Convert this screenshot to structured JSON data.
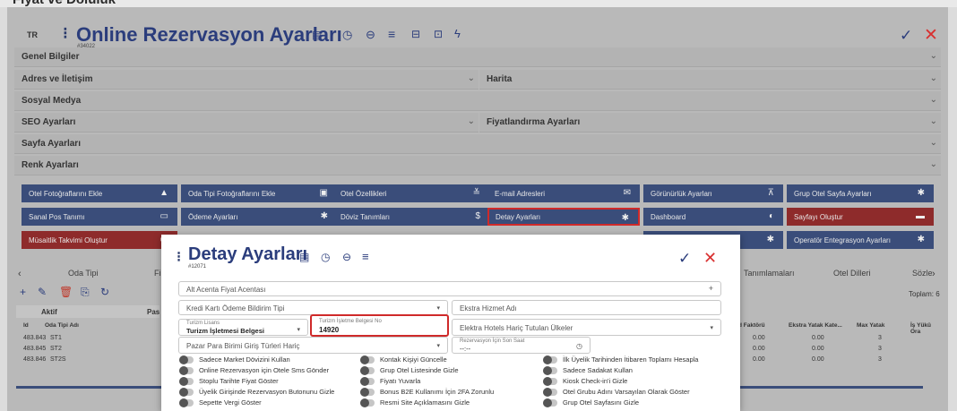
{
  "top_strip": "Fiyat ve Doluluk",
  "header": {
    "lang": "TR",
    "title": "Online Rezervasyon Ayarları",
    "subid": "#34022",
    "icons": [
      "list-icon",
      "history-icon",
      "lock-icon",
      "menu-icon",
      "print-icon",
      "save-icon",
      "bolt-icon"
    ]
  },
  "accordions": [
    {
      "label": "Genel Bilgiler"
    },
    {
      "label": "Adres ve İletişim"
    },
    {
      "label": "Harita"
    },
    {
      "label": "Sosyal Medya"
    },
    {
      "label": "SEO Ayarları"
    },
    {
      "label": "Fiyatlandırma Ayarları"
    },
    {
      "label": "Sayfa Ayarları"
    },
    {
      "label": "Renk Ayarları"
    }
  ],
  "buttons": [
    {
      "label": "Otel Fotoğraflarını Ekle",
      "icon": "▲"
    },
    {
      "label": "Oda Tipi Fotoğraflarını Ekle",
      "icon": "▣"
    },
    {
      "label": "Otel Özellikleri",
      "icon": "≚"
    },
    {
      "label": "E-mail Adresleri",
      "icon": "✉"
    },
    {
      "label": "Görünürlük Ayarları",
      "icon": "⊼"
    },
    {
      "label": "Grup Otel Sayfa Ayarları",
      "icon": "✱"
    },
    {
      "label": "Sanal Pos Tanımı",
      "icon": "▭"
    },
    {
      "label": "Ödeme Ayarları",
      "icon": "✱"
    },
    {
      "label": "Döviz Tanımları",
      "icon": "$"
    },
    {
      "label": "Detay Ayarları",
      "icon": "✱"
    },
    {
      "label": "Dashboard",
      "icon": "◐"
    },
    {
      "label": "Sayfayı Oluştur",
      "icon": "▬"
    },
    {
      "label": "Müsaitlik Takvimi Oluştur",
      "icon": "▭"
    },
    {
      "label": "",
      "icon": "✱"
    },
    {
      "label": "Operatör Entegrasyon Ayarları",
      "icon": "✱"
    }
  ],
  "tabs": {
    "oda_tipi": "Oda Tipi",
    "tanimlamalari": "Tanımlamaları",
    "otel_dilleri": "Otel Dilleri",
    "sozle": "Sözle",
    "fi": "Fi"
  },
  "grid": {
    "total": "Toplam: 6",
    "aktif": "Aktif",
    "pas": "Pas",
    "col_id": "Id",
    "col_oda_tipi_adi": "Oda Tipi Adı",
    "col_faktoru": "d Faktörü",
    "col_ekstra": "Ekstra Yatak Kate...",
    "col_max": "Max Yatak",
    "col_is": "İş Yükü Ora",
    "rows": [
      {
        "id": "483.843",
        "name": "ST1",
        "f": "0.00",
        "e": "0.00",
        "m": "3"
      },
      {
        "id": "483.845",
        "name": "ST2",
        "f": "0.00",
        "e": "0.00",
        "m": "3"
      },
      {
        "id": "483.846",
        "name": "ST2S",
        "f": "0.00",
        "e": "0.00",
        "m": "3"
      }
    ]
  },
  "modal": {
    "title": "Detay Ayarları",
    "id": "#12071",
    "fields": {
      "alt_acenta": "Alt Acenta Fiyat Acentası",
      "kredi_karti": "Kredi Kartı Ödeme Bildirim Tipi",
      "ekstra_hizmet": "Ekstra Hizmet Adı",
      "turizm_lisans_label": "Turizm Lisans",
      "turizm_lisans_value": "Turizm İşletmesi Belgesi",
      "belge_no_label": "Turizm İşletme Belgesi No",
      "belge_no_value": "14920",
      "elektra": "Elektra Hotels Hariç Tutulan Ülkeler",
      "pazar_para": "Pazar Para Birimi Giriş Türleri Hariç",
      "rez_son_saat_label": "Rezervasyon İçin Son Saat",
      "rez_son_saat_value": "--:--"
    },
    "toggles": [
      "Sadece Market Dövizini Kullan",
      "Kontak Kişiyi Güncelle",
      "İlk Üyelik Tarihinden İtibaren Toplamı Hesapla",
      "Online Rezervasyon için Otele Sms Gönder",
      "Grup Otel Listesinde Gizle",
      "Sadece Sadakat Kullan",
      "Stoplu Tarihte Fiyat Göster",
      "Fiyatı Yuvarla",
      "Kiosk Check-in'i Gizle",
      "Üyelik Girişinde Rezervasyon Butonunu Gizle",
      "Bonus B2E Kullanımı İçin 2FA Zorunlu",
      "Otel Grubu Adını Varsayılan Olarak Göster",
      "Sepette Vergi Göster",
      "Resmi Site Açıklamasını Gizle",
      "Grup Otel Sayfasını Gizle"
    ]
  },
  "colors": {
    "navy": "#3a4d7a",
    "red_btn": "#8e2b2b",
    "accent_red": "#cf2a2a",
    "title_blue": "#2b3d7c"
  }
}
